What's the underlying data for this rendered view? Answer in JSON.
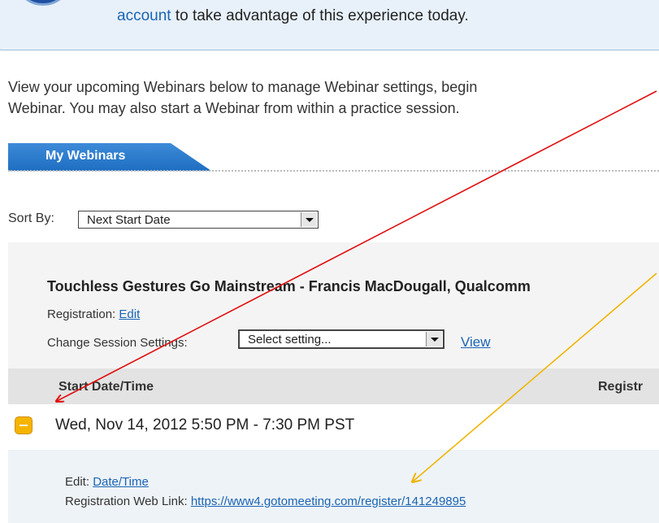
{
  "notice": {
    "link_text": "account",
    "text": "to take advantage of this experience today."
  },
  "intro": {
    "line1": "View your upcoming Webinars below to manage Webinar settings, begin",
    "line2": "Webinar. You may also start a Webinar from within a practice session."
  },
  "tab": {
    "label": "My Webinars"
  },
  "sort": {
    "label": "Sort By:",
    "value": "Next Start Date"
  },
  "webinar": {
    "title": "Touchless Gestures Go Mainstream - Francis MacDougall, Qualcomm",
    "registration_label": "Registration:",
    "registration_edit": "Edit",
    "settings_label": "Change Session Settings:",
    "settings_value": "Select setting...",
    "view_link": "View"
  },
  "table": {
    "col_start": "Start Date/Time",
    "col_reg": "Registr"
  },
  "session": {
    "date": "Wed, Nov 14, 2012 5:50 PM - 7:30 PM PST",
    "edit_label": "Edit:",
    "edit_link": "Date/Time",
    "weblink_label": "Registration Web Link:",
    "weblink_url": "https://www4.gotomeeting.com/register/141249895"
  },
  "colors": {
    "notice_bg": "#e8f1fa",
    "tab_blue": "#1e6ec2",
    "link": "#1a64b4",
    "collapse_button": "#f4b400",
    "arrow_red": "#e01010",
    "arrow_yellow": "#f0b400"
  }
}
